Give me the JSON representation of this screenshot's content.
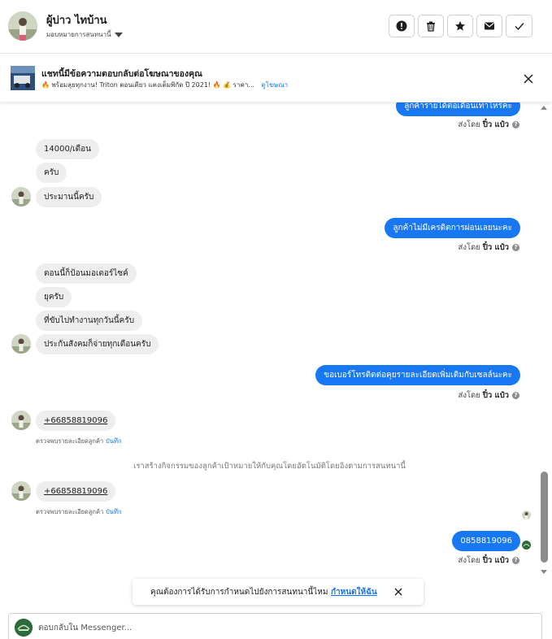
{
  "header": {
    "contact_name": "ผู้บ่าว ไทบ้าน",
    "subtitle": "มอบหมายการสนทนานี้",
    "buttons": [
      "mark-spam",
      "delete",
      "star",
      "mark-unread",
      "mark-done"
    ]
  },
  "ad": {
    "title": "แชทนี้มีข้อความตอบกลับต่อโฆษณาของคุณ",
    "description": "🔥 พร้อมลุยทุกงาน! Triton ตอนเดียว แคงเต็มพิกัด ปี 2021! 🔥 💰 ราคา...",
    "link_label": "ดูโฆษณา"
  },
  "messages": {
    "out_partial": "ลูกค้ารายได้ต่อเดือนเท่าไหร่คะ",
    "sent_by_prefix": "ส่งโดย",
    "sent_by_name": "ปิ๋ว แป๋ว",
    "in_1": "14000/เดือน",
    "in_2": "ครับ",
    "in_3": "ประมานนี้ครับ",
    "out_2": "ลูกค้าไม่มีเครดิตการผ่อนเลยนะคะ",
    "in_4": "ตอนนี้ก็ป้อนมอเตอร์ไซค์",
    "in_5": "ยุครับ",
    "in_6": "ที่ขับไปทำงานทุกวันนี้ครับ",
    "in_7": "ประกันสังคมก็จ่ายทุกเดือนครับ",
    "out_3": "ขอเบอร์โทรติดต่อคุยรายละเอียดเพิ่มเติมกับเซลล์นะคะ",
    "phone": "+66858819096",
    "note_label": "ตรวจพบรายละเอียดลูกค้า",
    "note_link": "บันทึก",
    "system": "เราสร้างกิจกรรมของลูกค้าเป้าหมายให้กับคุณโดยอัตโนมัติโดยอิงตามการสนทนานี้",
    "out_4": "0858819096"
  },
  "toast": {
    "text": "คุณต้องการได้รับการกำหนดไปยังการสนทนานี้ไหม",
    "link": "กำหนดให้ฉัน"
  },
  "composer": {
    "placeholder": "ตอบกลับใน Messenger..."
  },
  "colors": {
    "accent": "#1877f2",
    "incoming_bubble": "#eeeeef",
    "page_bg": "#ffffff"
  }
}
